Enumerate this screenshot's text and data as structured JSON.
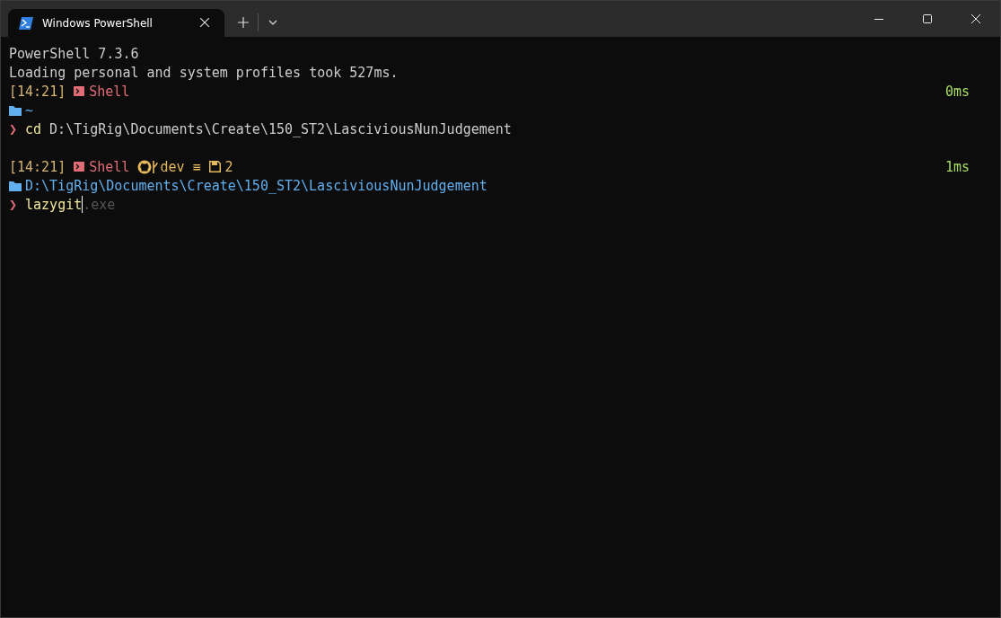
{
  "window": {
    "tabs": [
      {
        "title": "Windows PowerShell",
        "selected": true
      }
    ]
  },
  "terminal": {
    "lines": [
      {
        "kind": "output",
        "text": "PowerShell 7.3.6"
      },
      {
        "kind": "output",
        "text": "Loading personal and system profiles took 527ms."
      },
      {
        "kind": "status",
        "time": "[14:21]",
        "shell": "Shell",
        "duration": "0ms"
      },
      {
        "kind": "path",
        "path": "~"
      },
      {
        "kind": "command",
        "chevron": "❯",
        "command": "cd",
        "args": "D:\\TigRig\\Documents\\Create\\150_ST2\\LasciviousNunJudgement"
      },
      {
        "kind": "blank"
      },
      {
        "kind": "status",
        "time": "[14:21]",
        "shell": "Shell",
        "branch": "dev",
        "sync": "≡",
        "changes": "2",
        "duration": "1ms"
      },
      {
        "kind": "path",
        "path": "D:\\TigRig\\Documents\\Create\\150_ST2\\LasciviousNunJudgement"
      },
      {
        "kind": "command",
        "chevron": "❯",
        "command": "lazygit",
        "suggestion": ".exe",
        "cursor": true
      }
    ]
  }
}
